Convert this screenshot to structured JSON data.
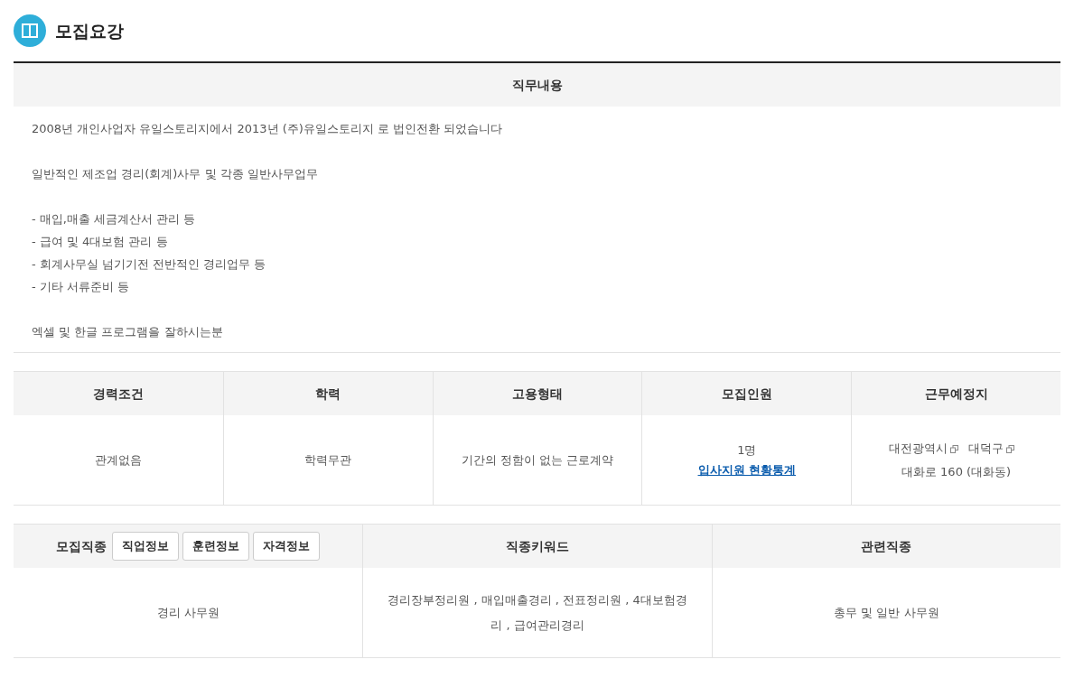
{
  "section": {
    "title": "모집요강"
  },
  "job_description": {
    "heading": "직무내용",
    "paragraphs": [
      {
        "lines": [
          "2008년 개인사업자 유일스토리지에서 2013년 (주)유일스토리지 로 법인전환 되었습니다"
        ]
      },
      {
        "lines": [
          "일반적인 제조업 경리(회계)사무 및 각종 일반사무업무"
        ]
      },
      {
        "lines": [
          "- 매입,매출 세금계산서 관리 등",
          "- 급여 및 4대보험 관리 등",
          "- 회계사무실 넘기기전 전반적인 경리업무 등",
          "- 기타 서류준비 등"
        ]
      },
      {
        "lines": [
          "엑셀 및 한글 프로그램을 잘하시는분"
        ]
      }
    ]
  },
  "conditions": {
    "columns": [
      "경력조건",
      "학력",
      "고용형태",
      "모집인원",
      "근무예정지"
    ],
    "experience": "관계없음",
    "education": "학력무관",
    "employment_type": "기간의 정함이 없는 근로계약",
    "headcount": "1명",
    "stats_link": "입사지원 현황통계",
    "location": {
      "regions": [
        "대전광역시",
        "대덕구"
      ],
      "address": "대화로 160 (대화동)"
    }
  },
  "occupation": {
    "label": "모집직종",
    "buttons": [
      "직업정보",
      "훈련정보",
      "자격정보"
    ],
    "columns": [
      "직종키워드",
      "관련직종"
    ],
    "job": "경리 사무원",
    "keywords": "경리장부정리원 , 매입매출경리 , 전표정리원 , 4대보험경리 , 급여관리경리",
    "related": "총무 및 일반 사무원"
  }
}
